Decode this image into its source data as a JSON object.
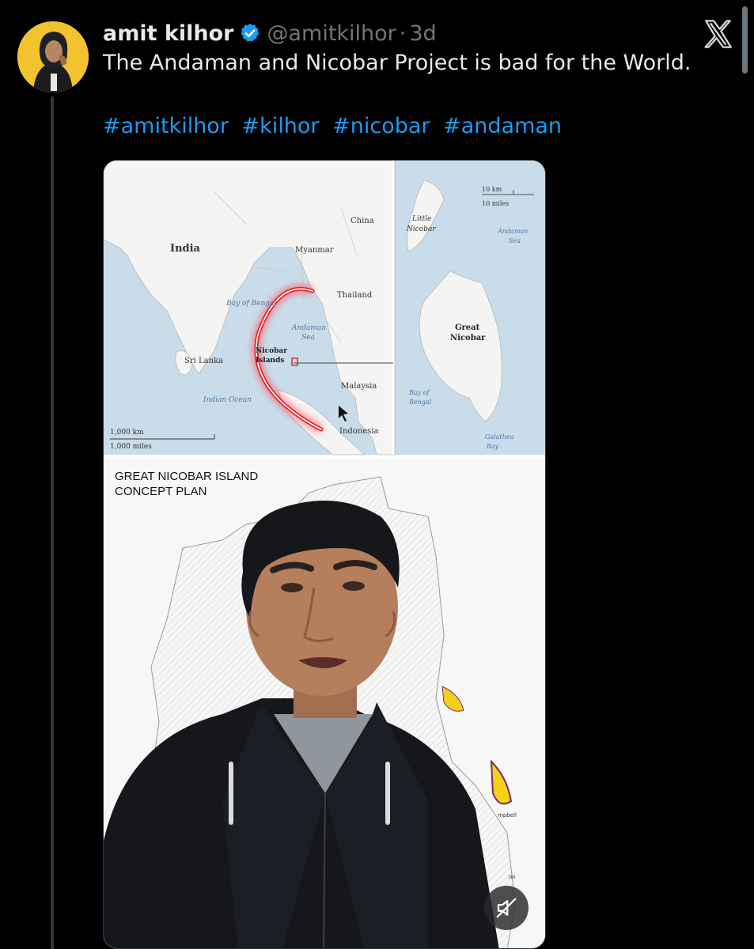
{
  "post": {
    "author_name": "amit kilhor",
    "handle": "@amitkilhor",
    "separator": "·",
    "time": "3d",
    "text": "The Andaman and Nicobar Project is bad for the World.",
    "hashtags": [
      "#amitkilhor",
      "#kilhor",
      "#nicobar",
      "#andaman"
    ]
  },
  "map": {
    "country_labels": {
      "india": "India",
      "china": "China",
      "myanmar": "Myanmar",
      "thailand": "Thailand",
      "sri_lanka": "Sri Lanka",
      "malaysia": "Malaysia",
      "indonesia": "Indonesia"
    },
    "sea_labels": {
      "bay_of_bengal": "Bay of Bengal",
      "andaman_sea_1": "Andaman",
      "andaman_sea_2": "Sea",
      "indian_ocean": "Indian Ocean",
      "nicobar_1": "Nicobar",
      "nicobar_2": "Islands"
    },
    "scale_main": {
      "km": "1,000 km",
      "miles": "1,000 miles"
    },
    "inset": {
      "scale_km": "10 km",
      "scale_miles": "10 miles",
      "little_nicobar_1": "Little",
      "little_nicobar_2": "Nicobar",
      "andaman_sea_1": "Andaman",
      "andaman_sea_2": "Sea",
      "great_nicobar_1": "Great",
      "great_nicobar_2": "Nicobar",
      "bay_bengal_1": "Bay of",
      "bay_bengal_2": "Bengal",
      "galathea_1": "Galathea",
      "galathea_2": "Bay"
    }
  },
  "concept_plan": {
    "title": "GREAT NICOBAR ISLAND\nCONCEPT PLAN",
    "partial_label_1": "mpbell",
    "partial_label_2": "on"
  },
  "colors": {
    "background": "#000000",
    "accent": "#1d9bf0",
    "muted": "#71767b",
    "highlight_arc": "#e8202a"
  },
  "icons": {
    "verified": "verified-badge-icon",
    "x_logo": "x-logo-icon",
    "mute": "volume-muted-icon"
  }
}
